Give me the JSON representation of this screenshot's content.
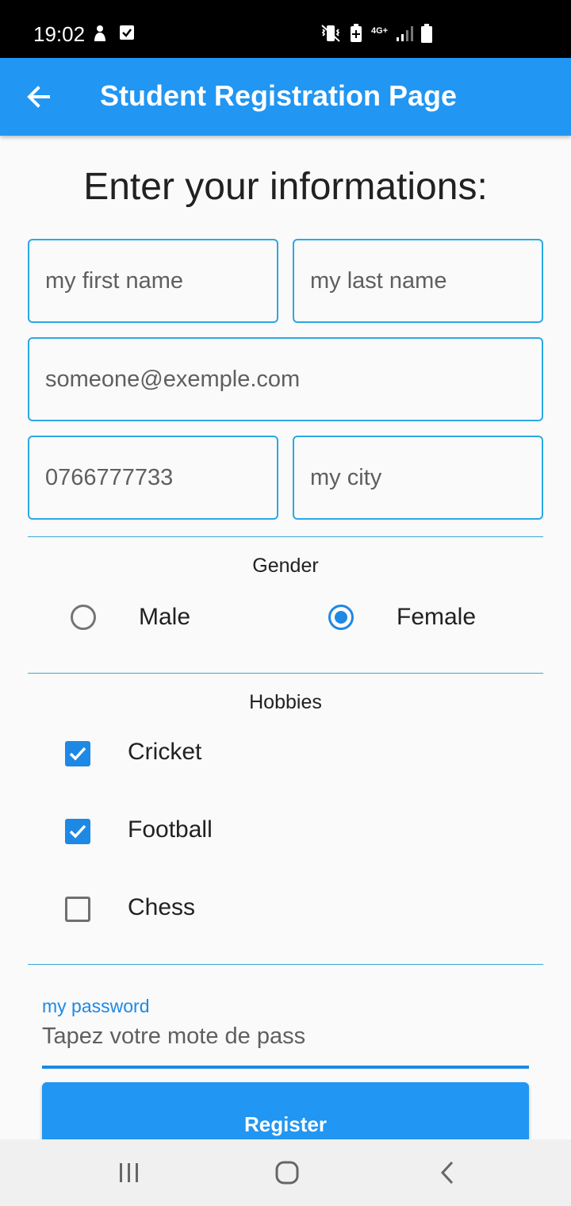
{
  "status_bar": {
    "time": "19:02",
    "network": "4G+",
    "icons_left": [
      "person-icon",
      "check-box-notification-icon"
    ],
    "icons_right": [
      "vibrate-icon",
      "battery-saver-icon",
      "data-arrows-icon",
      "signal-icon",
      "battery-icon"
    ]
  },
  "app_bar": {
    "title": "Student Registration Page",
    "back_icon": "arrow-back-icon",
    "color": "#2196f3"
  },
  "form": {
    "heading": "Enter your informations:",
    "first_name_placeholder": "my first name",
    "last_name_placeholder": "my last name",
    "email_placeholder": "someone@exemple.com",
    "phone_placeholder": "0766777733",
    "city_placeholder": "my city",
    "gender": {
      "label": "Gender",
      "options": [
        {
          "label": "Male",
          "selected": false
        },
        {
          "label": "Female",
          "selected": true
        }
      ]
    },
    "hobbies": {
      "label": "Hobbies",
      "items": [
        {
          "label": "Cricket",
          "checked": true
        },
        {
          "label": "Football",
          "checked": true
        },
        {
          "label": "Chess",
          "checked": false
        }
      ]
    },
    "password": {
      "label": "my password",
      "placeholder": "Tapez votre mote de pass"
    },
    "register_label": "Register"
  },
  "nav_bar": {
    "buttons": [
      "recent-apps-icon",
      "home-icon",
      "back-icon"
    ]
  },
  "colors": {
    "accent": "#1e88e5",
    "field_border": "#29a9e6"
  }
}
